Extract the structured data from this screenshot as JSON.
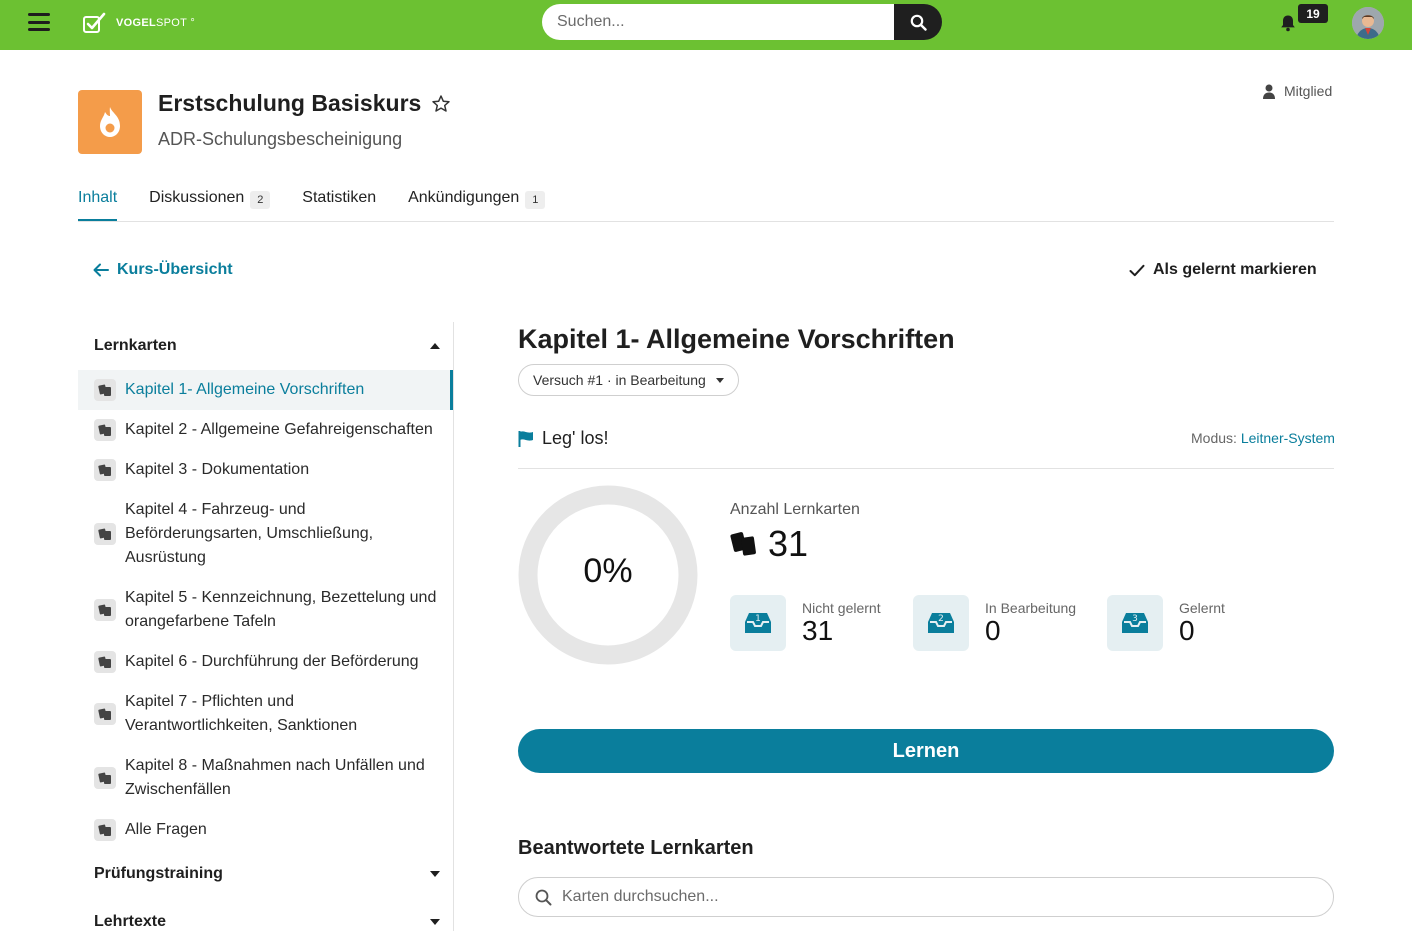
{
  "header": {
    "logo_text_bold": "VOGEL",
    "logo_text_thin": "SPOT",
    "search_placeholder": "Suchen...",
    "notification_count": "19"
  },
  "course": {
    "title": "Erstschulung Basiskurs",
    "subtitle": "ADR-Schulungsbescheinigung",
    "role": "Mitglied"
  },
  "tabs": [
    {
      "label": "Inhalt",
      "count": ""
    },
    {
      "label": "Diskussionen",
      "count": "2"
    },
    {
      "label": "Statistiken",
      "count": ""
    },
    {
      "label": "Ankündigungen",
      "count": "1"
    }
  ],
  "actions": {
    "back": "Kurs-Übersicht",
    "mark_learned": "Als gelernt markieren"
  },
  "sidebar": {
    "section_flashcards": "Lernkarten",
    "section_exam": "Prüfungstraining",
    "section_texts": "Lehrtexte",
    "items": [
      {
        "label": "Kapitel 1- Allgemeine Vorschriften"
      },
      {
        "label": "Kapitel 2 - Allgemeine Gefahreigenschaften"
      },
      {
        "label": "Kapitel 3 - Dokumentation"
      },
      {
        "label": "Kapitel 4 - Fahrzeug- und Beförderungsarten, Umschließung, Ausrüstung"
      },
      {
        "label": "Kapitel 5 - Kennzeichnung, Bezettelung und orangefarbene Tafeln"
      },
      {
        "label": "Kapitel 6 - Durchführung der Beförderung"
      },
      {
        "label": "Kapitel 7 - Pflichten und Verantwortlichkeiten, Sanktionen"
      },
      {
        "label": "Kapitel 8 - Maßnahmen nach Unfällen und Zwischenfällen"
      },
      {
        "label": "Alle Fragen"
      }
    ]
  },
  "main": {
    "chapter_title": "Kapitel 1- Allgemeine Vorschriften",
    "attempt": "Versuch #1 · in Bearbeitung",
    "go_label": "Leg' los!",
    "mode_label": "Modus:",
    "mode_value": "Leitner-System",
    "progress_percent": 0,
    "progress_text": "0%",
    "count_label": "Anzahl Lernkarten",
    "count_value": "31",
    "stats": [
      {
        "box": "1",
        "label": "Nicht gelernt",
        "value": "31"
      },
      {
        "box": "2",
        "label": "In Bearbeitung",
        "value": "0"
      },
      {
        "box": "3",
        "label": "Gelernt",
        "value": "0"
      }
    ],
    "learn_button": "Lernen",
    "answered_title": "Beantwortete Lernkarten",
    "cards_search_placeholder": "Karten durchsuchen..."
  },
  "colors": {
    "topbar": "#6cc132",
    "accent": "#0a7e9c",
    "course_icon": "#f49c4a"
  }
}
